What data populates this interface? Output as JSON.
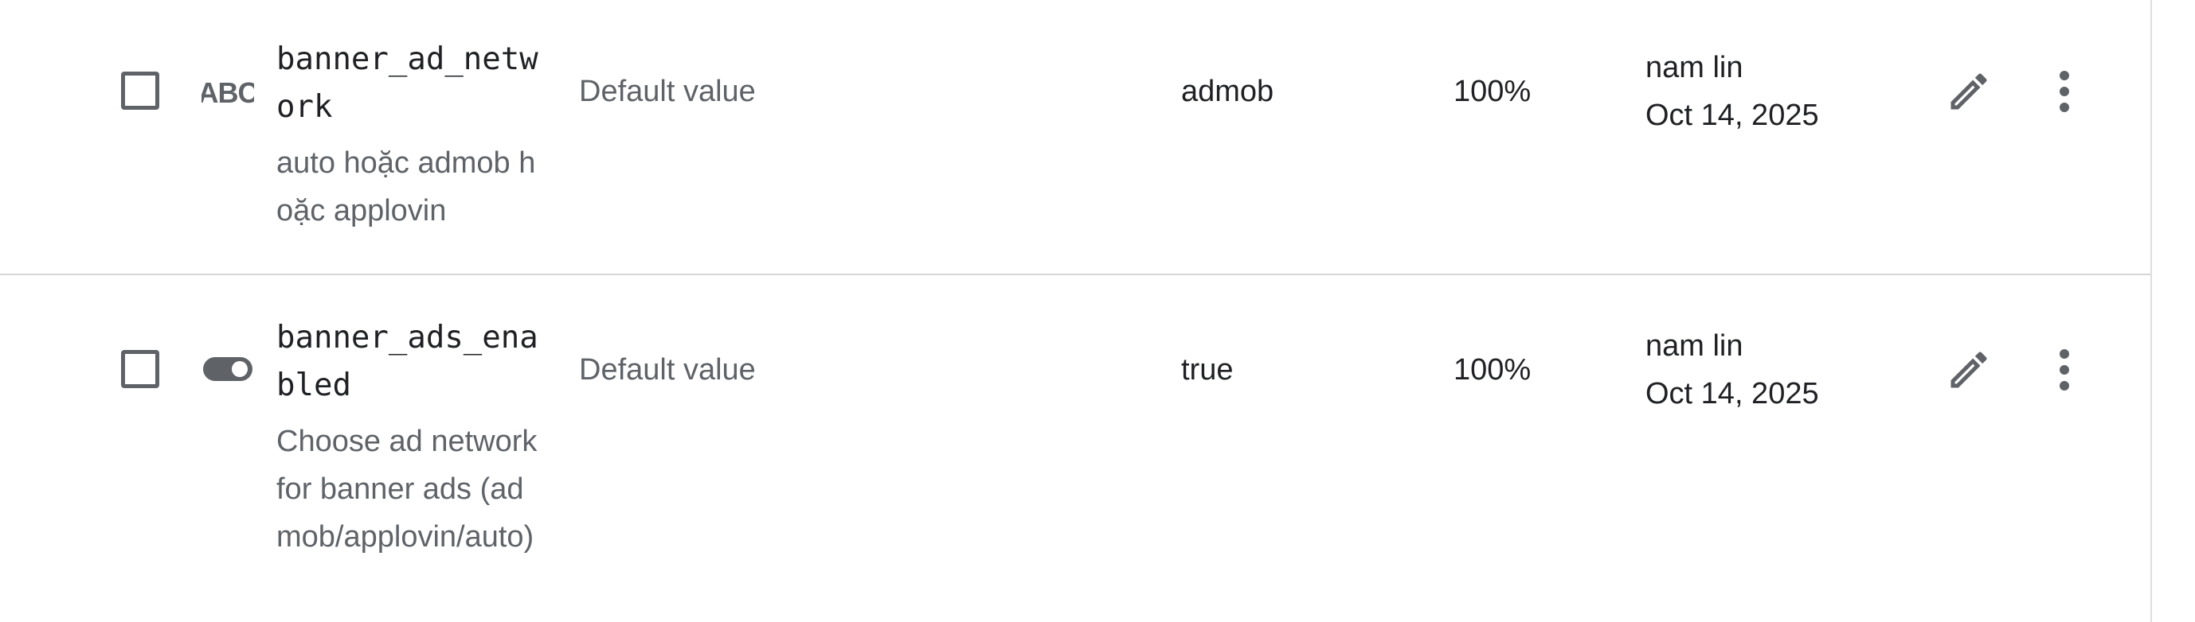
{
  "rows": [
    {
      "key": "banner_ad_network",
      "type_icon": "text-abc-icon",
      "description": "auto hoặc admob hoặc applovin",
      "condition": "Default value",
      "value": "admob",
      "percentage": "100%",
      "updated_by": "nam lin",
      "updated_date": "Oct 14, 2025",
      "actions": [
        "pencil-icon",
        "more-vert-icon"
      ]
    },
    {
      "key": "banner_ads_enabled",
      "type_icon": "toggle-boolean-icon",
      "description": "Choose ad network for banner ads (admob/applovin/auto)",
      "condition": "Default value",
      "value": "true",
      "percentage": "100%",
      "updated_by": "nam lin",
      "updated_date": "Oct 14, 2025",
      "actions": [
        "pencil-icon",
        "more-vert-icon"
      ]
    }
  ],
  "colors": {
    "primary_text": "#202124",
    "secondary_text": "#5f6368",
    "divider": "#d6d6d6"
  }
}
